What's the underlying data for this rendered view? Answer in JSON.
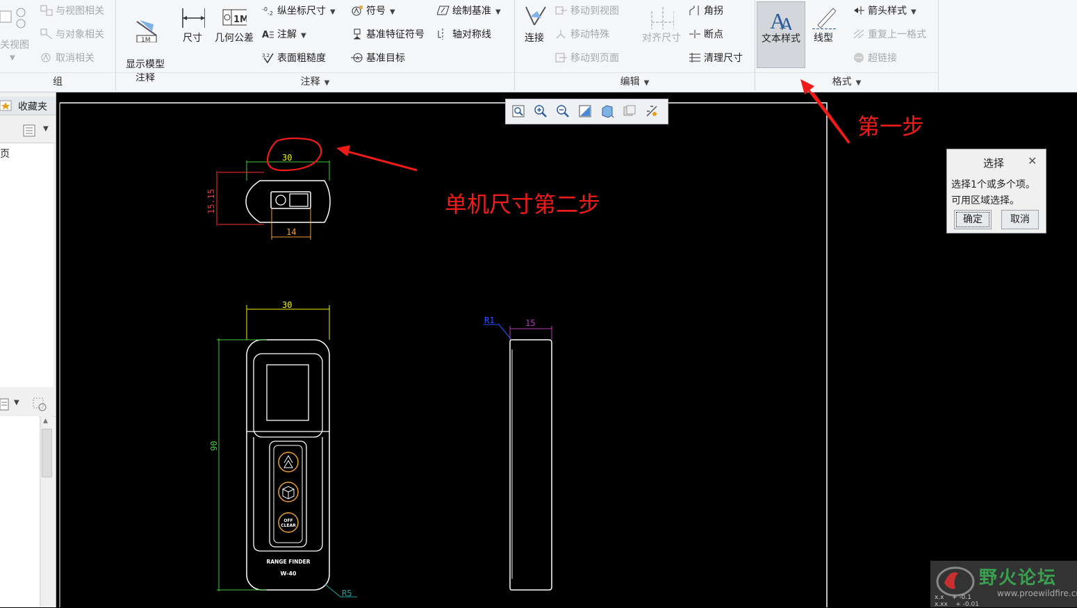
{
  "ribbon": {
    "group_zu": {
      "label": "组",
      "items": [
        "与视图相关",
        "与对象相关",
        "取消相关"
      ],
      "partial_view_label": "关视图"
    },
    "group_annotation": {
      "label": "注释",
      "show_model_annotation": "显示模型\n注释",
      "dimension": "尺寸",
      "geometric_tolerance": "几何公差",
      "ordinate_dimension": "纵坐标尺寸",
      "note": "注解",
      "surface_finish": "表面粗糙度",
      "symbol": "符号",
      "datum_feature_symbol": "基准特征符号",
      "datum_target": "基准目标",
      "sketch_datum": "绘制基准",
      "axis_of_symmetry": "轴对称线"
    },
    "group_edit": {
      "label": "编辑",
      "connect": "连接",
      "move_to_view": "移动到视图",
      "move_special": "移动特殊",
      "move_to_page": "移动到页面",
      "align_dimensions": "对齐尺寸",
      "jog": "角拐",
      "break": "断点",
      "cleanup_dimensions": "清理尺寸"
    },
    "group_format": {
      "label": "格式",
      "text_style": "文本样式",
      "line_style": "线型",
      "arrow_style": "箭头样式",
      "repeat_last_format": "重复上一格式",
      "hyperlink": "超链接"
    }
  },
  "left_panel": {
    "favorites": "收藏夹",
    "item_page": "页"
  },
  "annotations": {
    "step_one": "第一步",
    "step_two": "单机尺寸第二步"
  },
  "drawing": {
    "top_view": {
      "width_dim": "30",
      "height_dim": "15.15",
      "lower_dim": "14"
    },
    "front_view": {
      "width_dim": "30",
      "height_dim": "90",
      "radius": "R5",
      "label_line1": "RANGE FINDER",
      "label_line2": "W-40",
      "button3": "OFF\nCLEAR"
    },
    "side_view": {
      "width_dim": "15",
      "radius": "R1"
    }
  },
  "select_dialog": {
    "title": "选择",
    "message_line1": "选择1个或多个项。",
    "message_line2": "可用区域选择。",
    "ok": "确定",
    "cancel": "取消"
  },
  "watermark": {
    "name": "野火论坛",
    "url": "www.proewildfire.cn",
    "tolerance_1": "x.x    + -0.1",
    "tolerance_2": "x.xx    + -0.01"
  },
  "colors": {
    "dim_yellow": "#f5f500",
    "dim_red": "#ff3030",
    "dim_green": "#39d939",
    "dim_orange": "#f0a030",
    "dim_purple": "#b03db0",
    "dim_blue": "#3050ff",
    "dim_cyan": "#20a0a0",
    "annotation_red": "#ee1b1b"
  }
}
